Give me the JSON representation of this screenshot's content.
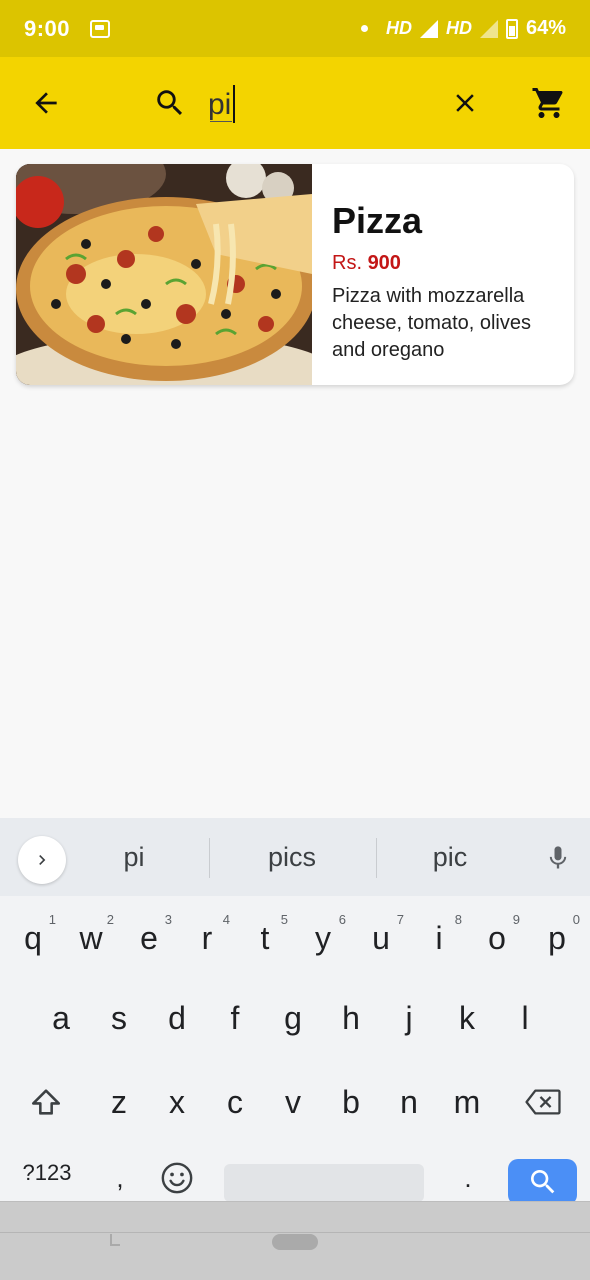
{
  "status_bar": {
    "time": "9:00",
    "network_1": "HD",
    "network_2": "HD",
    "battery": "64%"
  },
  "toolbar": {
    "background_color": "#f3d400",
    "search": {
      "value": "pi",
      "placeholder": ""
    },
    "icons": [
      "back-arrow-icon",
      "search-icon",
      "close-icon",
      "cart-icon"
    ]
  },
  "results": [
    {
      "title": "Pizza",
      "price_prefix": "Rs.",
      "price": "900",
      "description": "Pizza with mozzarella cheese, tomato, olives and oregano"
    }
  ],
  "keyboard": {
    "suggestions": [
      "pi",
      "pics",
      "pic"
    ],
    "row1": [
      {
        "key": "q",
        "hint": "1"
      },
      {
        "key": "w",
        "hint": "2"
      },
      {
        "key": "e",
        "hint": "3"
      },
      {
        "key": "r",
        "hint": "4"
      },
      {
        "key": "t",
        "hint": "5"
      },
      {
        "key": "y",
        "hint": "6"
      },
      {
        "key": "u",
        "hint": "7"
      },
      {
        "key": "i",
        "hint": "8"
      },
      {
        "key": "o",
        "hint": "9"
      },
      {
        "key": "p",
        "hint": "0"
      }
    ],
    "row2": [
      "a",
      "s",
      "d",
      "f",
      "g",
      "h",
      "j",
      "k",
      "l"
    ],
    "row3": [
      "z",
      "x",
      "c",
      "v",
      "b",
      "n",
      "m"
    ],
    "symbols_label": "?123",
    "comma": ",",
    "period": ".",
    "accent_color": "#4b8ff6"
  }
}
